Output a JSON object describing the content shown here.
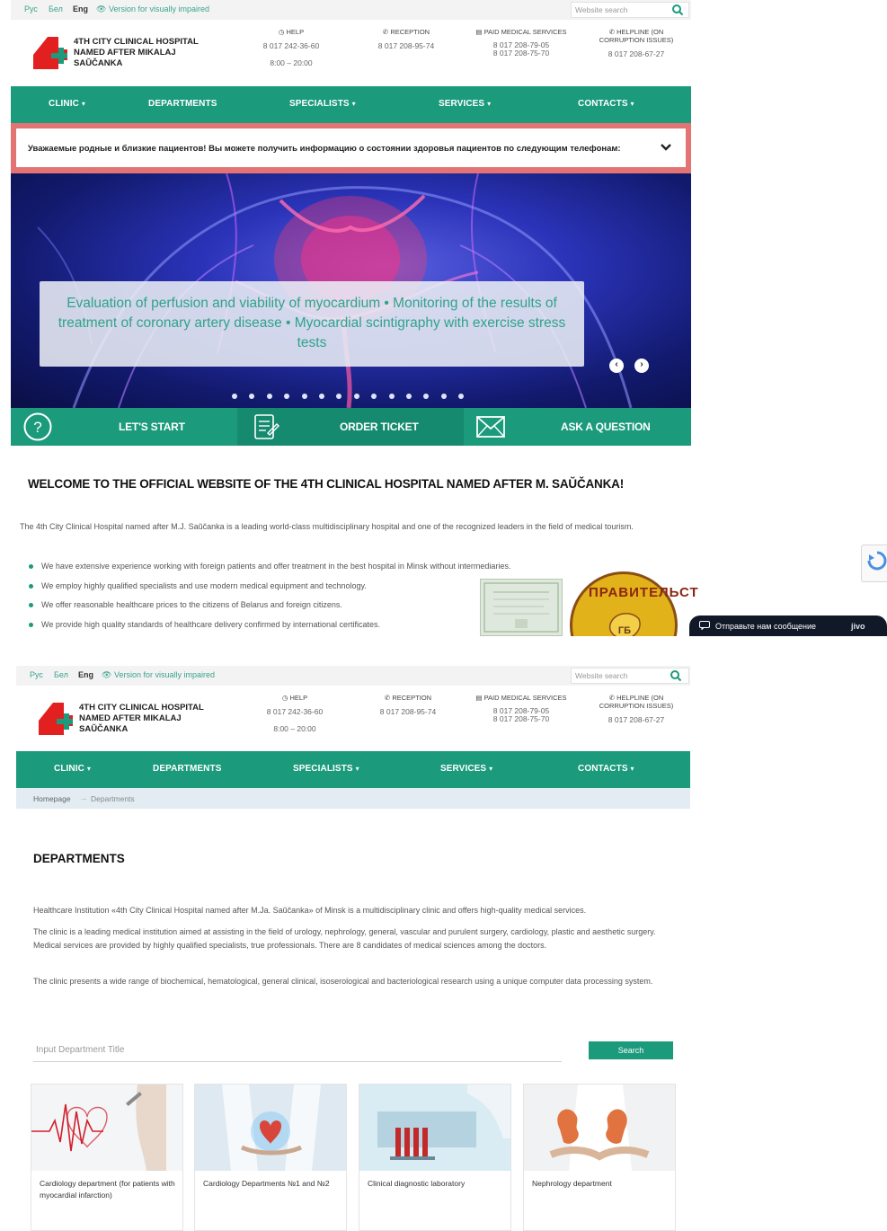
{
  "topbar": {
    "languages": [
      "Рус",
      "Бел",
      "Eng"
    ],
    "active_language": "Eng",
    "vision_link": "Version for visually impaired",
    "search_placeholder": "Website search"
  },
  "header": {
    "logo_line1": "4TH CITY CLINICAL HOSPITAL",
    "logo_line2": "NAMED AFTER MIKALAJ",
    "logo_line3": "SAŬČANKA",
    "help_title": "HELP",
    "help_phone": "8 017 242-36-60",
    "help_hours": "8:00 – 20:00",
    "reception_title": "RECEPTION",
    "reception_phone": "8 017 208-95-74",
    "paid_title": "PAID MEDICAL SERVICES",
    "paid_phone1": "8 017 208-79-05",
    "paid_phone2": "8 017 208-75-70",
    "helpline_title1": "HELPLINE (ON",
    "helpline_title2": "CORRUPTION ISSUES)",
    "helpline_phone": "8 017 208-67-27"
  },
  "nav": {
    "clinic": "CLINIC",
    "departments": "DEPARTMENTS",
    "specialists": "SPECIALISTS",
    "services": "SERVICES",
    "contacts": "CONTACTS",
    "caret": "▾"
  },
  "alert": {
    "text": "Уважаемые родные и близкие пациентов! Вы можете получить информацию о состоянии здоровья пациентов по следующим телефонам:"
  },
  "hero": {
    "caption": "Evaluation of perfusion and viability of myocardium • Monitoring of the results of treatment of coronary artery disease • Myocardial scintigraphy with exercise stress tests",
    "prev": "‹",
    "next": "›",
    "slide_count": 14
  },
  "actions": {
    "start": "LET'S START",
    "ticket": "ORDER TICKET",
    "question": "ASK A QUESTION",
    "help_glyph": "?"
  },
  "welcome": {
    "title": "WELCOME TO THE OFFICIAL WEBSITE OF THE 4TH CLINICAL HOSPITAL NAMED AFTER M. SAŬČANKA!",
    "intro": "The 4th City Clinical Hospital named after M.J. Saŭčanka is a leading world-class multidisciplinary hospital and one of the recognized leaders in the field of medical tourism.",
    "bullets": [
      "We have extensive experience working with foreign patients and offer treatment in the best hospital in Minsk without intermediaries.",
      "We employ highly qualified specialists and use modern medical equipment and technology.",
      "We offer reasonable healthcare prices to the citizens of Belarus and foreign citizens.",
      "We provide high quality standards of healthcare delivery confirmed by international certificates."
    ],
    "seal_text": "ПРАВИТЕЛЬСТ",
    "seal_center": "ГБ"
  },
  "widgets": {
    "chat_message": "Отправьте нам сообщение",
    "chat_brand": "jivo"
  },
  "departments_page": {
    "breadcrumb_home": "Homepage",
    "breadcrumb_sep": "→",
    "breadcrumb_current": "Departments",
    "title": "DEPARTMENTS",
    "p1": "Healthcare Institution «4th City Clinical Hospital named after M.Ja. Saŭčanka» of Minsk is a multidisciplinary clinic and offers high-quality medical services.",
    "p2": "The clinic is a leading medical institution aimed at assisting in the field of urology, nephrology, general, vascular and purulent surgery, cardiology, plastic and aesthetic surgery. Medical services are provided by highly qualified specialists, true professionals. There are 8 candidates of medical sciences among the doctors.",
    "p3": "The clinic presents a wide range of biochemical, hematological, general clinical, isoserological and bacteriological research using a unique computer data processing system.",
    "search_placeholder": "Input Department Title",
    "search_button": "Search",
    "cards": [
      "Cardiology department (for patients with myocardial infarction)",
      "Cardiology Departments №1 and №2",
      "Clinical diagnostic laboratory",
      "Nephrology department"
    ]
  },
  "colors": {
    "brand_green": "#1b9a7c",
    "alert_red": "#e47474",
    "logo_red": "#e32020"
  }
}
